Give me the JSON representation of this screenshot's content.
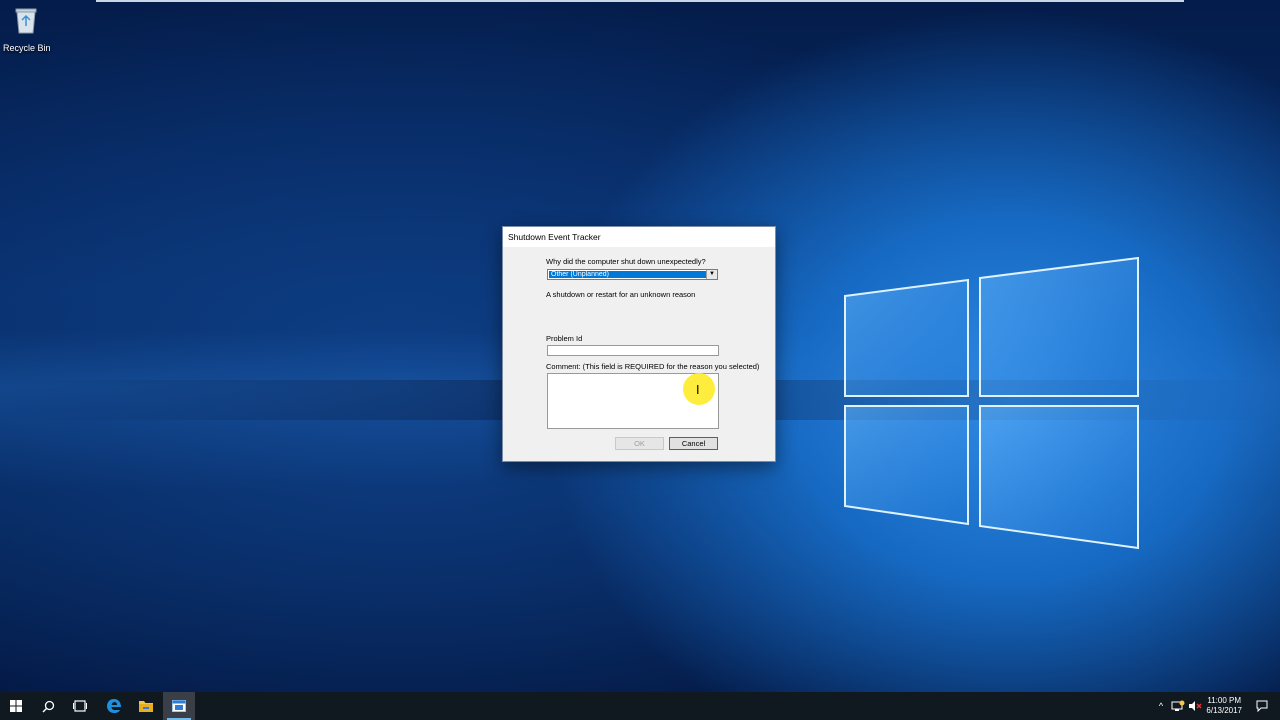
{
  "desktop": {
    "icons": [
      {
        "label": "Recycle Bin",
        "icon": "recycle-bin-icon"
      }
    ]
  },
  "dialog": {
    "title": "Shutdown Event Tracker",
    "question": "Why did the computer shut down unexpectedly?",
    "reason_selected": "Other (Unplanned)",
    "reason_description": "A shutdown or restart for an unknown reason",
    "problem_id_label": "Problem Id",
    "problem_id_value": "",
    "comment_label": "Comment: (This field is REQUIRED for the reason you selected)",
    "comment_value": "",
    "ok_label": "OK",
    "cancel_label": "Cancel"
  },
  "taskbar": {
    "items": [
      "start-icon",
      "search-icon",
      "task-view-icon",
      "edge-icon",
      "file-explorer-icon",
      "shutdown-tracker-icon"
    ],
    "clock_time": "11:00 PM",
    "clock_date": "6/13/2017"
  },
  "colors": {
    "accent": "#0078d7",
    "taskbar": "#101820",
    "cursor_highlight": "#ffeb28"
  }
}
